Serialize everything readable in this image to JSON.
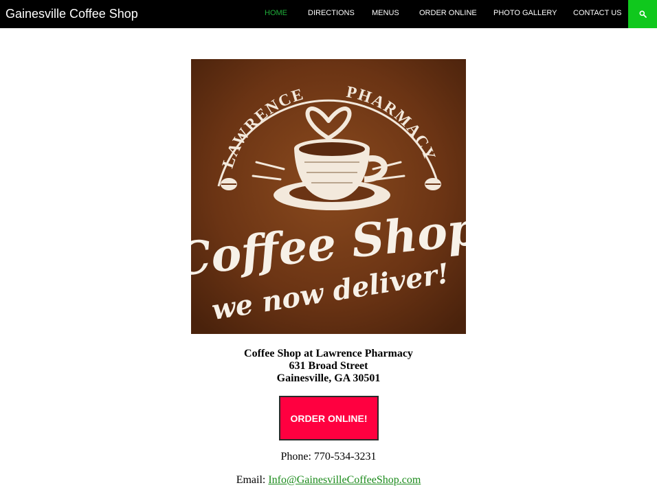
{
  "header": {
    "site_title": "Gainesville Coffee Shop",
    "nav": [
      {
        "label": "HOME",
        "active": true
      },
      {
        "label": "DIRECTIONS",
        "active": false
      },
      {
        "label": "MENUS",
        "active": false
      },
      {
        "label": "ORDER ONLINE",
        "active": false
      },
      {
        "label": "PHOTO GALLERY",
        "active": false
      },
      {
        "label": "CONTACT US",
        "active": false
      }
    ],
    "search_icon": "search-icon"
  },
  "logo": {
    "arc_left": "LAWRENCE",
    "arc_right": "PHARMACY",
    "main": "Coffee Shop",
    "tagline": "we now deliver!"
  },
  "address": {
    "line1": "Coffee Shop at Lawrence Pharmacy",
    "line2": "631 Broad Street",
    "line3": "Gainesville, GA 30501"
  },
  "order_button": "ORDER ONLINE!",
  "phone": "Phone: 770-534-3231",
  "email": {
    "label": "Email: ",
    "link": "Info@GainesvilleCoffeeShop.com"
  },
  "colors": {
    "topbar": "#000000",
    "nav_active": "#1fae3a",
    "search_bg": "#10c81d",
    "order_button": "#ff0040",
    "link": "#1a8a1a",
    "logo_bg": "#6b3414"
  }
}
